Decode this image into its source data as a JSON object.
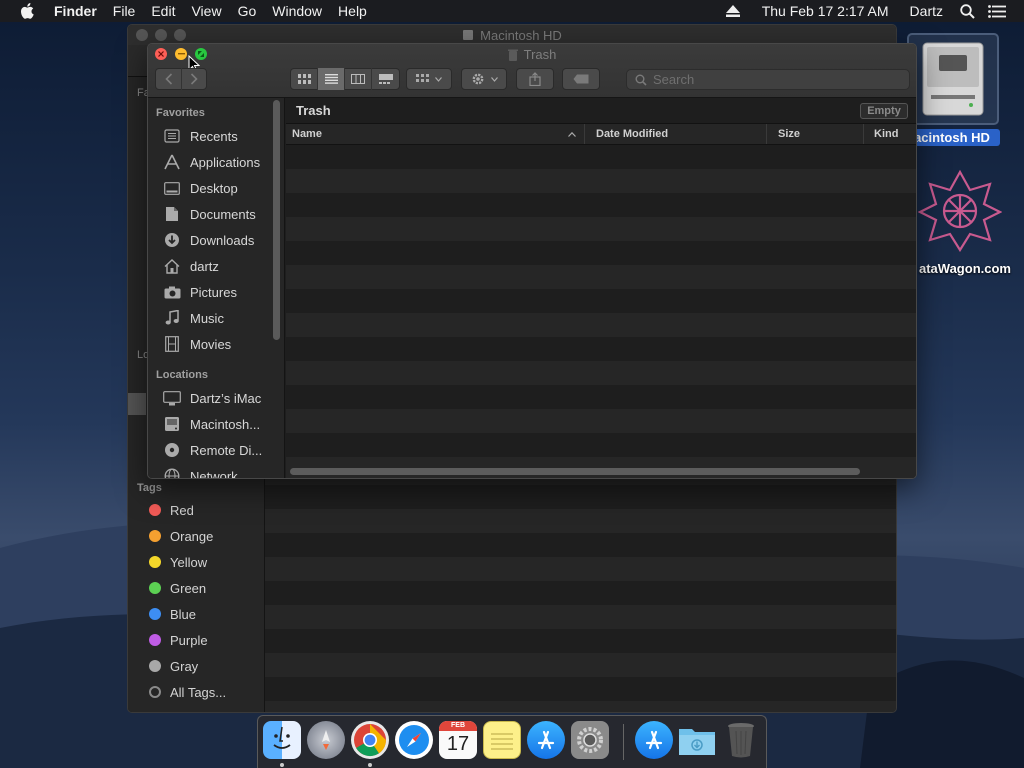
{
  "menubar": {
    "app": "Finder",
    "items": [
      "File",
      "Edit",
      "View",
      "Go",
      "Window",
      "Help"
    ],
    "datetime": "Thu Feb 17  2:17 AM",
    "user": "Dartz"
  },
  "back_window": {
    "title": "Macintosh HD",
    "peek_favorites": "Fa",
    "peek_locations": "Lo",
    "tags_header": "Tags",
    "tags": [
      {
        "label": "Red",
        "color": "#f25b57"
      },
      {
        "label": "Orange",
        "color": "#f5a030"
      },
      {
        "label": "Yellow",
        "color": "#f4d72a"
      },
      {
        "label": "Green",
        "color": "#5cd053"
      },
      {
        "label": "Blue",
        "color": "#3d8ef3"
      },
      {
        "label": "Purple",
        "color": "#bf5ce5"
      },
      {
        "label": "Gray",
        "color": "#a8a8a8"
      },
      {
        "label": "All Tags...",
        "color": ""
      }
    ]
  },
  "front_window": {
    "title": "Trash",
    "search_placeholder": "Search",
    "path_title": "Trash",
    "empty_button": "Empty",
    "columns": [
      "Name",
      "Date Modified",
      "Size",
      "Kind"
    ],
    "favorites_header": "Favorites",
    "favorites": [
      {
        "label": "Recents",
        "icon": "recents-icon"
      },
      {
        "label": "Applications",
        "icon": "applications-icon"
      },
      {
        "label": "Desktop",
        "icon": "desktop-icon"
      },
      {
        "label": "Documents",
        "icon": "documents-icon"
      },
      {
        "label": "Downloads",
        "icon": "downloads-icon"
      },
      {
        "label": "dartz",
        "icon": "home-icon"
      },
      {
        "label": "Pictures",
        "icon": "camera-icon"
      },
      {
        "label": "Music",
        "icon": "music-icon"
      },
      {
        "label": "Movies",
        "icon": "film-icon"
      }
    ],
    "locations_header": "Locations",
    "locations": [
      {
        "label": "Dartz’s iMac",
        "icon": "imac-icon"
      },
      {
        "label": "Macintosh...",
        "icon": "hard-drive-icon"
      },
      {
        "label": "Remote Di...",
        "icon": "disc-icon"
      },
      {
        "label": "Network",
        "icon": "network-icon"
      }
    ]
  },
  "desktop": {
    "hd_label": "acintosh HD",
    "datawagon_label": "ataWagon.com"
  },
  "dock": {
    "apps": [
      "finder-icon",
      "launchpad-icon",
      "chrome-icon",
      "safari-icon",
      "calendar-icon",
      "notes-icon",
      "app-store-icon",
      "system-preferences-icon",
      "app-store-download-icon",
      "downloads-folder-icon",
      "trash-icon"
    ],
    "calendar_month": "FEB",
    "calendar_day": "17"
  }
}
